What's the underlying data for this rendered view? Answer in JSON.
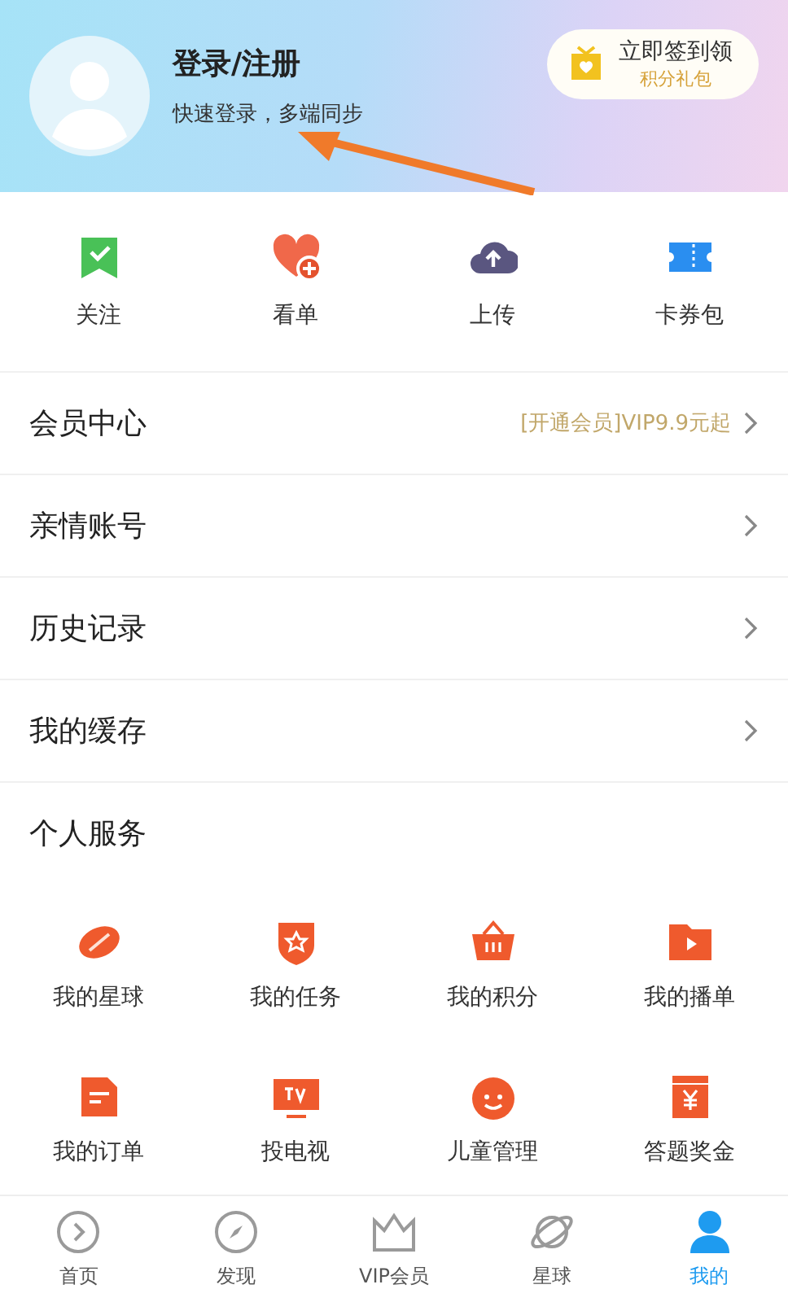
{
  "profile": {
    "title": "登录/注册",
    "subtitle": "快速登录，多端同步"
  },
  "sign_in_button": {
    "title": "立即签到领",
    "subtitle": "积分礼包"
  },
  "quick_links": [
    {
      "kind": "follow",
      "label": "关注"
    },
    {
      "kind": "watchlist",
      "label": "看单"
    },
    {
      "kind": "upload",
      "label": "上传"
    },
    {
      "kind": "coupons",
      "label": "卡券包"
    }
  ],
  "menu": [
    {
      "label": "会员中心",
      "note": "[开通会员]VIP9.9元起"
    },
    {
      "label": "亲情账号"
    },
    {
      "label": "历史记录"
    },
    {
      "label": "我的缓存"
    }
  ],
  "services": {
    "title": "个人服务",
    "items": [
      {
        "kind": "planet",
        "label": "我的星球"
      },
      {
        "kind": "task",
        "label": "我的任务"
      },
      {
        "kind": "basket",
        "label": "我的积分"
      },
      {
        "kind": "playlist",
        "label": "我的播单"
      },
      {
        "kind": "order",
        "label": "我的订单"
      },
      {
        "kind": "tv",
        "label": "投电视"
      },
      {
        "kind": "kid",
        "label": "儿童管理"
      },
      {
        "kind": "bonus",
        "label": "答题奖金"
      }
    ]
  },
  "tab_bar": [
    {
      "kind": "home",
      "label": "首页",
      "selected": false
    },
    {
      "kind": "discover",
      "label": "发现",
      "selected": false
    },
    {
      "kind": "vip",
      "label": "VIP会员",
      "selected": false
    },
    {
      "kind": "planet",
      "label": "星球",
      "selected": false
    },
    {
      "kind": "me",
      "label": "我的",
      "selected": true
    }
  ]
}
